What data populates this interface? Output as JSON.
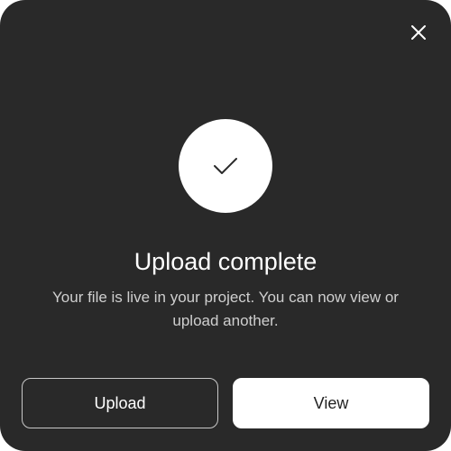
{
  "dialog": {
    "close_icon": "close-icon",
    "status_icon": "checkmark-icon",
    "title": "Upload complete",
    "message": "Your file is live in your project. You can now view or upload another.",
    "upload_label": "Upload",
    "view_label": "View"
  },
  "colors": {
    "dialog_background": "#292929",
    "primary_button_background": "#ffffff",
    "primary_button_text": "#222222",
    "secondary_button_border": "#c8c8c8",
    "text": "#ffffff",
    "muted_text": "#cfcfcf"
  }
}
